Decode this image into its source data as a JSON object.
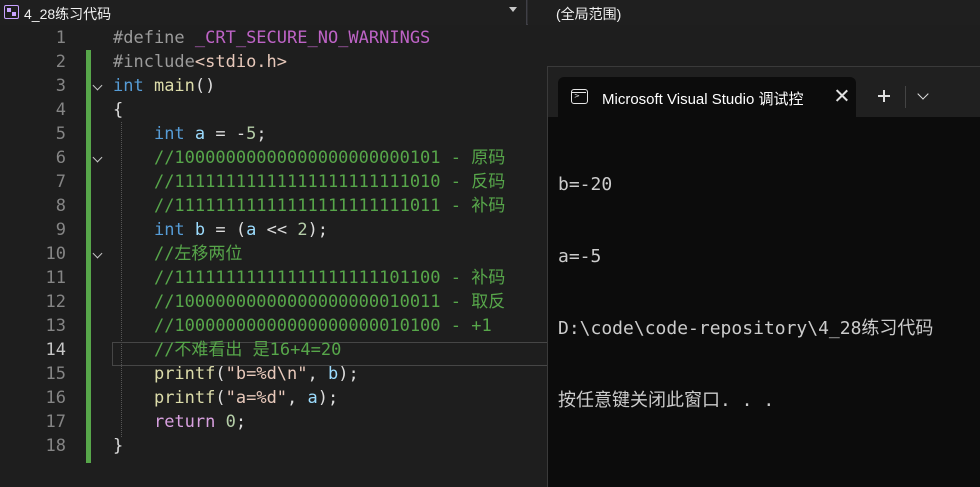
{
  "navbar": {
    "project": "4_28练习代码",
    "scope": "(全局范围)"
  },
  "editor": {
    "current_line": 14,
    "lines": [
      {
        "n": "1",
        "tokens": [
          [
            "t-prep",
            "#define "
          ],
          [
            "t-macro",
            "_CRT_SECURE_NO_WARNINGS"
          ]
        ]
      },
      {
        "n": "2",
        "tokens": [
          [
            "t-prep",
            "#include"
          ],
          [
            "t-str",
            "<stdio.h>"
          ]
        ]
      },
      {
        "n": "3",
        "tokens": [
          [
            "t-kw",
            "int "
          ],
          [
            "t-fn",
            "main"
          ],
          [
            "t-plain",
            "()"
          ]
        ]
      },
      {
        "n": "4",
        "tokens": [
          [
            "t-plain",
            "{"
          ]
        ]
      },
      {
        "n": "5",
        "tokens": [
          [
            "t-plain",
            "    "
          ],
          [
            "t-kw",
            "int "
          ],
          [
            "t-id",
            "a"
          ],
          [
            "t-plain",
            " = -"
          ],
          [
            "t-num",
            "5"
          ],
          [
            "t-plain",
            ";"
          ]
        ]
      },
      {
        "n": "6",
        "tokens": [
          [
            "t-plain",
            "    "
          ],
          [
            "t-cmt",
            "//10000000000000000000000101 - 原码"
          ]
        ]
      },
      {
        "n": "7",
        "tokens": [
          [
            "t-plain",
            "    "
          ],
          [
            "t-cmt",
            "//11111111111111111111111010 - 反码"
          ]
        ]
      },
      {
        "n": "8",
        "tokens": [
          [
            "t-plain",
            "    "
          ],
          [
            "t-cmt",
            "//11111111111111111111111011 - 补码"
          ]
        ]
      },
      {
        "n": "9",
        "tokens": [
          [
            "t-plain",
            "    "
          ],
          [
            "t-kw",
            "int "
          ],
          [
            "t-id",
            "b"
          ],
          [
            "t-plain",
            " = ("
          ],
          [
            "t-id",
            "a"
          ],
          [
            "t-plain",
            " << "
          ],
          [
            "t-num",
            "2"
          ],
          [
            "t-plain",
            ");"
          ]
        ]
      },
      {
        "n": "10",
        "tokens": [
          [
            "t-plain",
            "    "
          ],
          [
            "t-cmt",
            "//左移两位"
          ]
        ]
      },
      {
        "n": "11",
        "tokens": [
          [
            "t-plain",
            "    "
          ],
          [
            "t-cmt",
            "//11111111111111111111101100 - 补码"
          ]
        ]
      },
      {
        "n": "12",
        "tokens": [
          [
            "t-plain",
            "    "
          ],
          [
            "t-cmt",
            "//10000000000000000000010011 - 取反"
          ]
        ]
      },
      {
        "n": "13",
        "tokens": [
          [
            "t-plain",
            "    "
          ],
          [
            "t-cmt",
            "//10000000000000000000010100 - +1"
          ]
        ]
      },
      {
        "n": "14",
        "tokens": [
          [
            "t-plain",
            "    "
          ],
          [
            "t-cmt",
            "//不难看出 是16+4=20"
          ]
        ]
      },
      {
        "n": "15",
        "tokens": [
          [
            "t-plain",
            "    "
          ],
          [
            "t-fn",
            "printf"
          ],
          [
            "t-plain",
            "("
          ],
          [
            "t-str",
            "\"b=%d\\n\""
          ],
          [
            "t-plain",
            ", "
          ],
          [
            "t-id",
            "b"
          ],
          [
            "t-plain",
            ");"
          ]
        ]
      },
      {
        "n": "16",
        "tokens": [
          [
            "t-plain",
            "    "
          ],
          [
            "t-fn",
            "printf"
          ],
          [
            "t-plain",
            "("
          ],
          [
            "t-str",
            "\"a=%d\""
          ],
          [
            "t-plain",
            ", "
          ],
          [
            "t-id",
            "a"
          ],
          [
            "t-plain",
            ");"
          ]
        ]
      },
      {
        "n": "17",
        "tokens": [
          [
            "t-plain",
            "    "
          ],
          [
            "t-ret",
            "return "
          ],
          [
            "t-num",
            "0"
          ],
          [
            "t-plain",
            ";"
          ]
        ]
      },
      {
        "n": "18",
        "tokens": [
          [
            "t-plain",
            "}"
          ]
        ]
      }
    ]
  },
  "console": {
    "tab_title": "Microsoft Visual Studio 调试控",
    "icons": {
      "tab": "terminal-icon",
      "close": "close-icon",
      "new": "plus-icon",
      "menu": "chevron-down-icon"
    },
    "output": [
      "b=-20",
      "a=-5",
      "D:\\code\\code-repository\\4_28练习代码",
      "按任意键关闭此窗口. . ."
    ]
  }
}
